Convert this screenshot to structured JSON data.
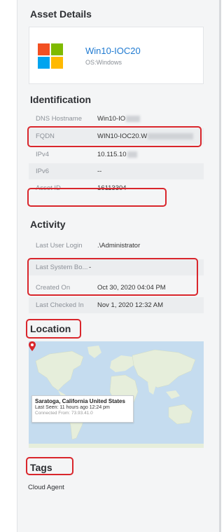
{
  "asset_details": {
    "heading": "Asset Details",
    "name": "Win10-IOC20",
    "os": "OS:Windows",
    "logo_colors": [
      "#f25022",
      "#7fba00",
      "#00a4ef",
      "#ffb900"
    ]
  },
  "identification": {
    "heading": "Identification",
    "rows": [
      {
        "label": "DNS Hostname",
        "value": "Win10-IO"
      },
      {
        "label": "FQDN",
        "value": "WIN10-IOC20.W"
      },
      {
        "label": "IPv4",
        "value": "10.115.10"
      },
      {
        "label": "IPv6",
        "value": "--"
      },
      {
        "label": "Asset ID",
        "value": "16113304"
      }
    ]
  },
  "activity": {
    "heading": "Activity",
    "rows": [
      {
        "label": "Last User Login",
        "value": ".\\Administrator"
      },
      {
        "label": "Last System Bo...",
        "value": "-"
      },
      {
        "label": "Created On",
        "value": "Oct 30, 2020 04:04 PM"
      },
      {
        "label": "Last Checked In",
        "value": "Nov 1, 2020 12:32 AM"
      }
    ]
  },
  "location": {
    "heading": "Location",
    "popup_title": "Saratoga, California United States",
    "popup_seen": "Last Seen: 11 hours ago 12:24 pm",
    "popup_connected": "Connected From: 73.93.41.0",
    "pin_icon": "map-pin-icon",
    "pin_color": "#d9262c"
  },
  "tags": {
    "heading": "Tags",
    "items": [
      "Cloud Agent"
    ]
  },
  "highlight_color": "#d9262c"
}
